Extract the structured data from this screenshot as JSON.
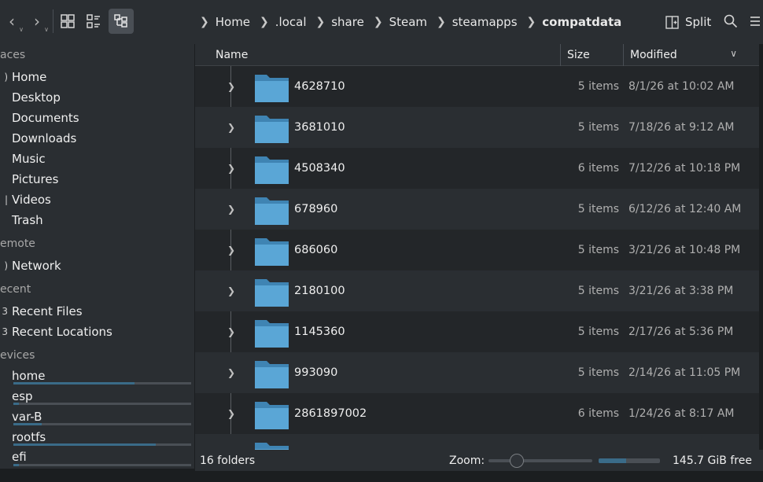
{
  "toolbar": {
    "breadcrumbs": [
      "Home",
      ".local",
      "share",
      "Steam",
      "steamapps",
      "compatdata"
    ],
    "split_label": "Split"
  },
  "sidebar": {
    "sections": {
      "places": "aces",
      "remote": "emote",
      "recent": "ecent",
      "devices": "evices"
    },
    "places": [
      {
        "label": "Home",
        "icon": "home-icon"
      },
      {
        "label": "Desktop",
        "icon": "desktop-icon"
      },
      {
        "label": "Documents",
        "icon": "documents-icon"
      },
      {
        "label": "Downloads",
        "icon": "downloads-icon"
      },
      {
        "label": "Music",
        "icon": "music-icon"
      },
      {
        "label": "Pictures",
        "icon": "pictures-icon"
      },
      {
        "label": "Videos",
        "icon": "videos-icon"
      },
      {
        "label": "Trash",
        "icon": "trash-icon"
      }
    ],
    "remote": [
      {
        "label": "Network",
        "icon": "network-icon"
      }
    ],
    "recent": [
      {
        "label": "Recent Files",
        "icon": "recent-files-icon"
      },
      {
        "label": "Recent Locations",
        "icon": "recent-locations-icon"
      }
    ],
    "devices": [
      {
        "label": "home",
        "usage": 0.68
      },
      {
        "label": "esp",
        "usage": 0.03
      },
      {
        "label": "var-B",
        "usage": 0.16
      },
      {
        "label": "rootfs",
        "usage": 0.8
      },
      {
        "label": "efi",
        "usage": 0.03
      }
    ]
  },
  "columns": {
    "name": "Name",
    "size": "Size",
    "modified": "Modified"
  },
  "files": [
    {
      "name": "4628710",
      "size": "5 items",
      "modified": "8/1/26 at 10:02 AM"
    },
    {
      "name": "3681010",
      "size": "5 items",
      "modified": "7/18/26 at 9:12 AM"
    },
    {
      "name": "4508340",
      "size": "6 items",
      "modified": "7/12/26 at 10:18 PM"
    },
    {
      "name": "678960",
      "size": "5 items",
      "modified": "6/12/26 at 12:40 AM"
    },
    {
      "name": "686060",
      "size": "5 items",
      "modified": "3/21/26 at 10:48 PM"
    },
    {
      "name": "2180100",
      "size": "5 items",
      "modified": "3/21/26 at 3:38 PM"
    },
    {
      "name": "1145360",
      "size": "5 items",
      "modified": "2/17/26 at 5:36 PM"
    },
    {
      "name": "993090",
      "size": "5 items",
      "modified": "2/14/26 at 11:05 PM"
    },
    {
      "name": "2861897002",
      "size": "6 items",
      "modified": "1/24/26 at 8:17 AM"
    },
    {
      "name": "",
      "size": "",
      "modified": ""
    }
  ],
  "status": {
    "count": "16 folders",
    "zoom_label": "Zoom:",
    "zoom_level": 0.24,
    "free_space": "145.7 GiB free",
    "disk_usage": 0.45
  },
  "colors": {
    "folder": "#5aa6d6",
    "folder_dark": "#3f84b3",
    "accent": "#3a6b88"
  }
}
